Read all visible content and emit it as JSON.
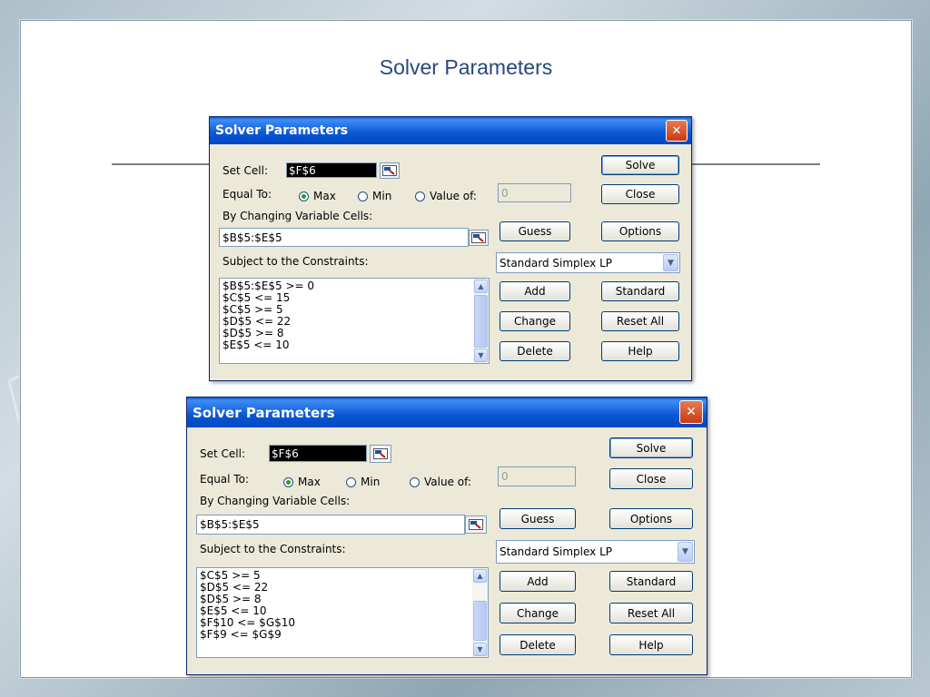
{
  "slide": {
    "title": "Solver Parameters"
  },
  "dialogs": [
    {
      "title": "Solver Parameters",
      "close_glyph": "✕",
      "set_cell_label": "Set Cell:",
      "set_cell_value": "$F$6",
      "equal_to_label": "Equal To:",
      "radio_max": "Max",
      "radio_min": "Min",
      "radio_value_of": "Value of:",
      "selected_radio": "max",
      "value_of_field": "0",
      "changing_label": "By Changing Variable Cells:",
      "changing_value": "$B$5:$E$5",
      "constraints_label": "Subject to the Constraints:",
      "constraints": [
        "$B$5:$E$5 >= 0",
        "$C$5 <= 15",
        "$C$5 >= 5",
        "$D$5 <= 22",
        "$D$5 >= 8",
        "$E$5 <= 10"
      ],
      "engine_value": "Standard Simplex LP",
      "buttons": {
        "solve": "Solve",
        "close": "Close",
        "guess": "Guess",
        "options": "Options",
        "add": "Add",
        "standard": "Standard",
        "change": "Change",
        "reset_all": "Reset All",
        "delete": "Delete",
        "help": "Help"
      }
    },
    {
      "title": "Solver Parameters",
      "close_glyph": "✕",
      "set_cell_label": "Set Cell:",
      "set_cell_value": "$F$6",
      "equal_to_label": "Equal To:",
      "radio_max": "Max",
      "radio_min": "Min",
      "radio_value_of": "Value of:",
      "selected_radio": "max",
      "value_of_field": "0",
      "changing_label": "By Changing Variable Cells:",
      "changing_value": "$B$5:$E$5",
      "constraints_label": "Subject to the Constraints:",
      "constraints": [
        "$C$5 >= 5",
        "$D$5 <= 22",
        "$D$5 >= 8",
        "$E$5 <= 10",
        "$F$10 <= $G$10",
        "$F$9 <= $G$9"
      ],
      "engine_value": "Standard Simplex LP",
      "buttons": {
        "solve": "Solve",
        "close": "Close",
        "guess": "Guess",
        "options": "Options",
        "add": "Add",
        "standard": "Standard",
        "change": "Change",
        "reset_all": "Reset All",
        "delete": "Delete",
        "help": "Help"
      }
    }
  ],
  "colors": {
    "title_text": "#27497c",
    "titlebar": "#0a57d4",
    "dialog_bg": "#ece9d8",
    "close_button": "#d9532c"
  }
}
